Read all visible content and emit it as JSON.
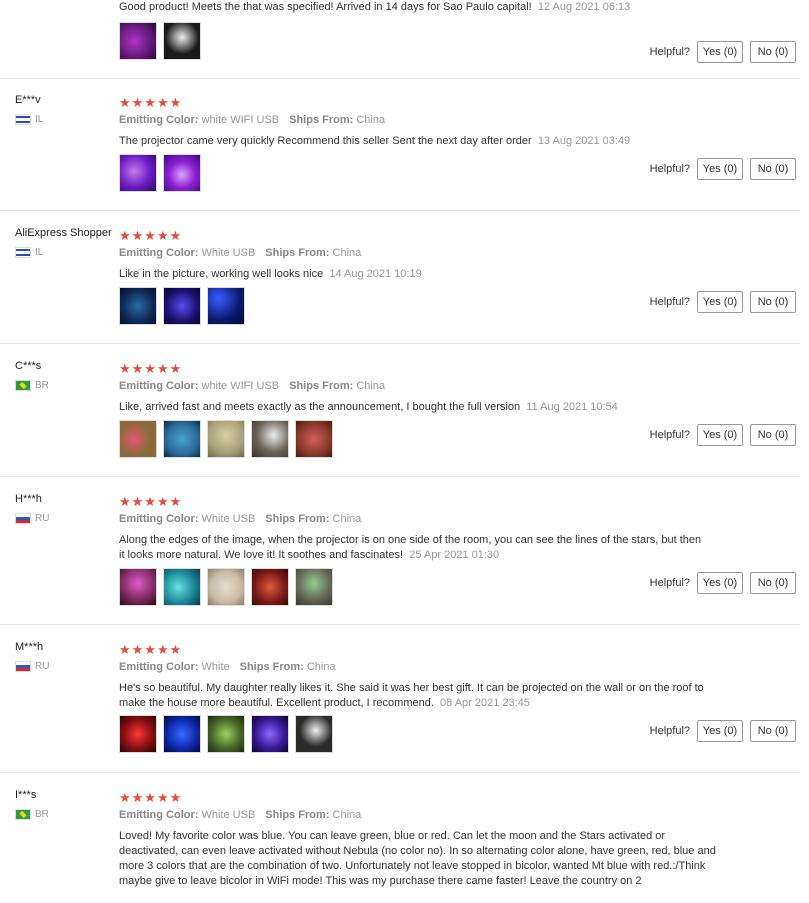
{
  "helpful_label": "Helpful?",
  "emitting_label": "Emitting Color:",
  "ships_label": "Ships From:",
  "reviews": [
    {
      "text": "Good product! Meets the that was specified! Arrived in 14 days for Sao Paulo capital!",
      "date": "12 Aug 2021 06:13",
      "yes": "Yes (0)",
      "no": "No (0)",
      "thumbs": [
        "#4a1060",
        "#1a1a1a"
      ]
    },
    {
      "user": "E***v",
      "country": "IL",
      "flag": "il",
      "stars": "★★★★★",
      "color": "white WIFI USB",
      "ships": "China",
      "text": "The projector came very quickly Recommend this seller Sent the next day after order",
      "date": "13 Aug 2021 03:49",
      "yes": "Yes (0)",
      "no": "No (0)",
      "thumbs": [
        "#7a2bd6",
        "#8a1fd2"
      ]
    },
    {
      "user": "AliExpress Shopper",
      "country": "IL",
      "flag": "il",
      "stars": "★★★★★",
      "color": "White USB",
      "ships": "China",
      "text": "Like in the picture, working well looks nice",
      "date": "14 Aug 2021 10:19",
      "yes": "Yes (0)",
      "no": "No (0)",
      "thumbs": [
        "#0d2a5a",
        "#1c1270",
        "#0b1a6e"
      ]
    },
    {
      "user": "C***s",
      "country": "BR",
      "flag": "br",
      "stars": "★★★★★",
      "color": "white WIFI USB",
      "ships": "China",
      "text": "Like, arrived fast and meets exactly as the announcement, I bought the full version",
      "date": "11 Aug 2021 10:54",
      "yes": "Yes (0)",
      "no": "No (0)",
      "thumbs": [
        "#8a6a3a",
        "#2d6c9a",
        "#a9a27a",
        "#6a6256",
        "#8a3a2a"
      ]
    },
    {
      "user": "H***h",
      "country": "RU",
      "flag": "ru",
      "stars": "★★★★★",
      "color": "White USB",
      "ships": "China",
      "text": "Along the edges of the image, when the projector is on one side of the room, you can see the lines of the stars, but then it looks more natural. We love it! It soothes and fascinates!",
      "date": "25 Apr 2021 01:30",
      "yes": "Yes (0)",
      "no": "No (0)",
      "thumbs": [
        "#7a2a5a",
        "#1d8a9a",
        "#c9bba6",
        "#7a1a1a",
        "#6a6a5a"
      ]
    },
    {
      "user": "M***h",
      "country": "RU",
      "flag": "ru",
      "stars": "★★★★★",
      "color": "White",
      "ships": "China",
      "text": "He's so beautiful. My daughter really likes it. She said it was her best gift. It can be projected on the wall or on the roof to make the house more beautiful. Excellent product, I recommend.",
      "date": "08 Apr 2021 23:45",
      "yes": "Yes (0)",
      "no": "No (0)",
      "thumbs": [
        "#8a0f0f",
        "#0f2ab0",
        "#4a6a2a",
        "#3a1a9a",
        "#2a2a2a"
      ]
    },
    {
      "user": "I***s",
      "country": "BR",
      "flag": "br",
      "stars": "★★★★★",
      "color": "White USB",
      "ships": "China",
      "text": "Loved! My favorite color was blue. You can leave green, blue or red. Can let the moon and the Stars activated or deactivated, can even leave activated without Nebula (no color no). In so alternating color alone, have green, red, blue and more 3 colors that are the combination of two. Unfortunately not leave stopped in bicolor, wanted Mt blue with red.:/Think maybe give to leave bicolor in WiFi mode! This was my purchase there came faster! Leave the country on 2",
      "date": "",
      "yes": "",
      "no": "",
      "thumbs": []
    }
  ]
}
